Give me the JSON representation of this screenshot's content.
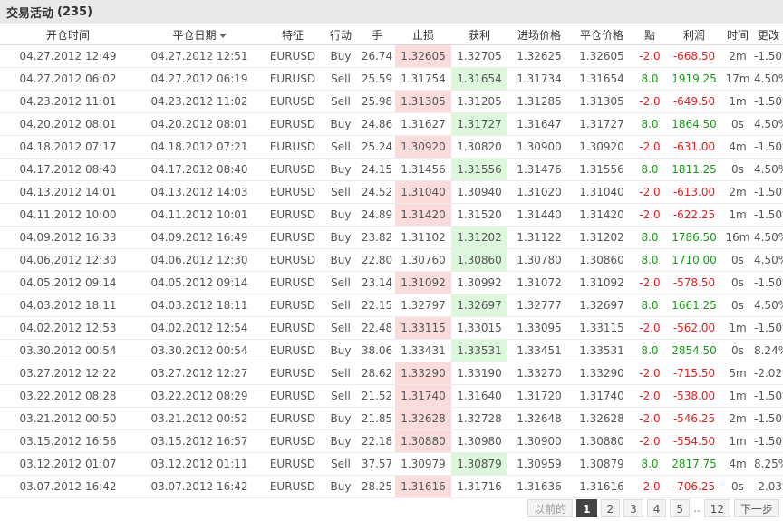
{
  "panel": {
    "title": "交易活动",
    "count": "(235)"
  },
  "columns": {
    "open_time": "开仓时间",
    "close_date": "平仓日期",
    "symbol": "特征",
    "action": "行动",
    "lots": "手",
    "stop_loss": "止损",
    "take_profit": "获利",
    "entry_price": "进场价格",
    "close_price": "平仓价格",
    "pips": "點",
    "profit": "利润",
    "duration": "时间",
    "change": "更改"
  },
  "rows": [
    {
      "open": "04.27.2012 12:49",
      "close": "04.27.2012 12:51",
      "sym": "EURUSD",
      "act": "Buy",
      "lots": "26.74",
      "sl": "1.32605",
      "tp": "1.32705",
      "entry": "1.32625",
      "exit": "1.32605",
      "pips": "-2.0",
      "profit": "-668.50",
      "dur": "2m",
      "chg": "-1.50%",
      "hit": "sl"
    },
    {
      "open": "04.27.2012 06:02",
      "close": "04.27.2012 06:19",
      "sym": "EURUSD",
      "act": "Sell",
      "lots": "25.59",
      "sl": "1.31754",
      "tp": "1.31654",
      "entry": "1.31734",
      "exit": "1.31654",
      "pips": "8.0",
      "profit": "1919.25",
      "dur": "17m",
      "chg": "4.50%",
      "hit": "tp"
    },
    {
      "open": "04.23.2012 11:01",
      "close": "04.23.2012 11:02",
      "sym": "EURUSD",
      "act": "Sell",
      "lots": "25.98",
      "sl": "1.31305",
      "tp": "1.31205",
      "entry": "1.31285",
      "exit": "1.31305",
      "pips": "-2.0",
      "profit": "-649.50",
      "dur": "1m",
      "chg": "-1.50%",
      "hit": "sl"
    },
    {
      "open": "04.20.2012 08:01",
      "close": "04.20.2012 08:01",
      "sym": "EURUSD",
      "act": "Buy",
      "lots": "24.86",
      "sl": "1.31627",
      "tp": "1.31727",
      "entry": "1.31647",
      "exit": "1.31727",
      "pips": "8.0",
      "profit": "1864.50",
      "dur": "0s",
      "chg": "4.50%",
      "hit": "tp"
    },
    {
      "open": "04.18.2012 07:17",
      "close": "04.18.2012 07:21",
      "sym": "EURUSD",
      "act": "Sell",
      "lots": "25.24",
      "sl": "1.30920",
      "tp": "1.30820",
      "entry": "1.30900",
      "exit": "1.30920",
      "pips": "-2.0",
      "profit": "-631.00",
      "dur": "4m",
      "chg": "-1.50%",
      "hit": "sl"
    },
    {
      "open": "04.17.2012 08:40",
      "close": "04.17.2012 08:40",
      "sym": "EURUSD",
      "act": "Buy",
      "lots": "24.15",
      "sl": "1.31456",
      "tp": "1.31556",
      "entry": "1.31476",
      "exit": "1.31556",
      "pips": "8.0",
      "profit": "1811.25",
      "dur": "0s",
      "chg": "4.50%",
      "hit": "tp"
    },
    {
      "open": "04.13.2012 14:01",
      "close": "04.13.2012 14:03",
      "sym": "EURUSD",
      "act": "Sell",
      "lots": "24.52",
      "sl": "1.31040",
      "tp": "1.30940",
      "entry": "1.31020",
      "exit": "1.31040",
      "pips": "-2.0",
      "profit": "-613.00",
      "dur": "2m",
      "chg": "-1.50%",
      "hit": "sl"
    },
    {
      "open": "04.11.2012 10:00",
      "close": "04.11.2012 10:01",
      "sym": "EURUSD",
      "act": "Buy",
      "lots": "24.89",
      "sl": "1.31420",
      "tp": "1.31520",
      "entry": "1.31440",
      "exit": "1.31420",
      "pips": "-2.0",
      "profit": "-622.25",
      "dur": "1m",
      "chg": "-1.50%",
      "hit": "sl"
    },
    {
      "open": "04.09.2012 16:33",
      "close": "04.09.2012 16:49",
      "sym": "EURUSD",
      "act": "Buy",
      "lots": "23.82",
      "sl": "1.31102",
      "tp": "1.31202",
      "entry": "1.31122",
      "exit": "1.31202",
      "pips": "8.0",
      "profit": "1786.50",
      "dur": "16m",
      "chg": "4.50%",
      "hit": "tp"
    },
    {
      "open": "04.06.2012 12:30",
      "close": "04.06.2012 12:30",
      "sym": "EURUSD",
      "act": "Buy",
      "lots": "22.80",
      "sl": "1.30760",
      "tp": "1.30860",
      "entry": "1.30780",
      "exit": "1.30860",
      "pips": "8.0",
      "profit": "1710.00",
      "dur": "0s",
      "chg": "4.50%",
      "hit": "tp"
    },
    {
      "open": "04.05.2012 09:14",
      "close": "04.05.2012 09:14",
      "sym": "EURUSD",
      "act": "Sell",
      "lots": "23.14",
      "sl": "1.31092",
      "tp": "1.30992",
      "entry": "1.31072",
      "exit": "1.31092",
      "pips": "-2.0",
      "profit": "-578.50",
      "dur": "0s",
      "chg": "-1.50%",
      "hit": "sl"
    },
    {
      "open": "04.03.2012 18:11",
      "close": "04.03.2012 18:11",
      "sym": "EURUSD",
      "act": "Sell",
      "lots": "22.15",
      "sl": "1.32797",
      "tp": "1.32697",
      "entry": "1.32777",
      "exit": "1.32697",
      "pips": "8.0",
      "profit": "1661.25",
      "dur": "0s",
      "chg": "4.50%",
      "hit": "tp"
    },
    {
      "open": "04.02.2012 12:53",
      "close": "04.02.2012 12:54",
      "sym": "EURUSD",
      "act": "Sell",
      "lots": "22.48",
      "sl": "1.33115",
      "tp": "1.33015",
      "entry": "1.33095",
      "exit": "1.33115",
      "pips": "-2.0",
      "profit": "-562.00",
      "dur": "1m",
      "chg": "-1.50%",
      "hit": "sl"
    },
    {
      "open": "03.30.2012 00:54",
      "close": "03.30.2012 00:54",
      "sym": "EURUSD",
      "act": "Buy",
      "lots": "38.06",
      "sl": "1.33431",
      "tp": "1.33531",
      "entry": "1.33451",
      "exit": "1.33531",
      "pips": "8.0",
      "profit": "2854.50",
      "dur": "0s",
      "chg": "8.24%",
      "hit": "tp"
    },
    {
      "open": "03.27.2012 12:22",
      "close": "03.27.2012 12:27",
      "sym": "EURUSD",
      "act": "Sell",
      "lots": "28.62",
      "sl": "1.33290",
      "tp": "1.33190",
      "entry": "1.33270",
      "exit": "1.33290",
      "pips": "-2.0",
      "profit": "-715.50",
      "dur": "5m",
      "chg": "-2.02%",
      "hit": "sl"
    },
    {
      "open": "03.22.2012 08:28",
      "close": "03.22.2012 08:29",
      "sym": "EURUSD",
      "act": "Sell",
      "lots": "21.52",
      "sl": "1.31740",
      "tp": "1.31640",
      "entry": "1.31720",
      "exit": "1.31740",
      "pips": "-2.0",
      "profit": "-538.00",
      "dur": "1m",
      "chg": "-1.50%",
      "hit": "sl"
    },
    {
      "open": "03.21.2012 00:50",
      "close": "03.21.2012 00:52",
      "sym": "EURUSD",
      "act": "Buy",
      "lots": "21.85",
      "sl": "1.32628",
      "tp": "1.32728",
      "entry": "1.32648",
      "exit": "1.32628",
      "pips": "-2.0",
      "profit": "-546.25",
      "dur": "2m",
      "chg": "-1.50%",
      "hit": "sl"
    },
    {
      "open": "03.15.2012 16:56",
      "close": "03.15.2012 16:57",
      "sym": "EURUSD",
      "act": "Buy",
      "lots": "22.18",
      "sl": "1.30880",
      "tp": "1.30980",
      "entry": "1.30900",
      "exit": "1.30880",
      "pips": "-2.0",
      "profit": "-554.50",
      "dur": "1m",
      "chg": "-1.50%",
      "hit": "sl"
    },
    {
      "open": "03.12.2012 01:07",
      "close": "03.12.2012 01:11",
      "sym": "EURUSD",
      "act": "Sell",
      "lots": "37.57",
      "sl": "1.30979",
      "tp": "1.30879",
      "entry": "1.30959",
      "exit": "1.30879",
      "pips": "8.0",
      "profit": "2817.75",
      "dur": "4m",
      "chg": "8.25%",
      "hit": "tp"
    },
    {
      "open": "03.07.2012 16:42",
      "close": "03.07.2012 16:42",
      "sym": "EURUSD",
      "act": "Buy",
      "lots": "28.25",
      "sl": "1.31616",
      "tp": "1.31716",
      "entry": "1.31636",
      "exit": "1.31616",
      "pips": "-2.0",
      "profit": "-706.25",
      "dur": "0s",
      "chg": "-2.03%",
      "hit": "sl"
    }
  ],
  "pagination": {
    "prev_label": "以前的",
    "pages": [
      "1",
      "2",
      "3",
      "4",
      "5"
    ],
    "ellipsis": "..",
    "last_page": "12",
    "next_label": "下一步",
    "current": "1"
  },
  "colors": {
    "stop_loss_hit_bg": "#fbdcdc",
    "take_profit_hit_bg": "#dcf7dc",
    "negative": "#e02020",
    "positive": "#1a9a1a"
  }
}
